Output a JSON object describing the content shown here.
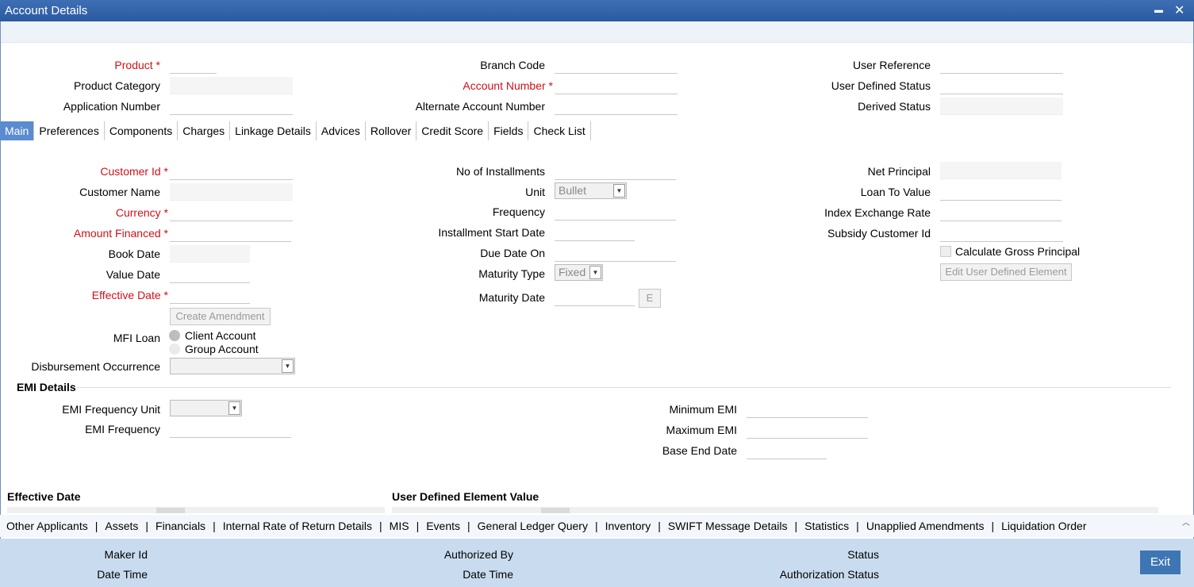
{
  "window": {
    "title": "Account Details",
    "minimize": "▬",
    "close": "✕"
  },
  "header": {
    "product": "Product",
    "product_category": "Product Category",
    "application_number": "Application Number",
    "branch_code": "Branch Code",
    "account_number": "Account Number",
    "alternate_account_number": "Alternate Account Number",
    "user_reference": "User Reference",
    "user_defined_status": "User Defined Status",
    "derived_status": "Derived Status",
    "required_mark": "*"
  },
  "tabs": [
    "Main",
    "Preferences",
    "Components",
    "Charges",
    "Linkage Details",
    "Advices",
    "Rollover",
    "Credit Score",
    "Fields",
    "Check List"
  ],
  "main": {
    "customer_id": "Customer Id",
    "customer_name": "Customer Name",
    "currency": "Currency",
    "amount_financed": "Amount Financed",
    "book_date": "Book Date",
    "value_date": "Value Date",
    "effective_date": "Effective Date",
    "create_amendment": "Create Amendment",
    "mfi_loan": "MFI Loan",
    "client_account": "Client Account",
    "group_account": "Group Account",
    "disbursement_occurrence": "Disbursement Occurrence",
    "no_of_installments": "No of Installments",
    "unit": "Unit",
    "unit_value": "Bullet",
    "frequency": "Frequency",
    "installment_start_date": "Installment Start Date",
    "due_date_on": "Due Date On",
    "maturity_type": "Maturity Type",
    "maturity_type_value": "Fixed",
    "maturity_date": "Maturity Date",
    "e_button": "E",
    "net_principal": "Net Principal",
    "loan_to_value": "Loan To Value",
    "index_exchange_rate": "Index Exchange Rate",
    "subsidy_customer_id": "Subsidy Customer Id",
    "calculate_gross_principal": "Calculate Gross Principal",
    "edit_user_defined_element": "Edit User Defined Element"
  },
  "emi": {
    "section_title": "EMI Details",
    "emi_frequency_unit": "EMI Frequency Unit",
    "emi_frequency": "EMI Frequency",
    "minimum_emi": "Minimum EMI",
    "maximum_emi": "Maximum EMI",
    "base_end_date": "Base End Date"
  },
  "grids": {
    "effective_date": "Effective Date",
    "user_defined_element_value": "User Defined Element Value"
  },
  "links": [
    "Other Applicants",
    "Assets",
    "Financials",
    "Internal Rate of Return Details",
    "MIS",
    "Events",
    "General Ledger Query",
    "Inventory",
    "SWIFT Message Details",
    "Statistics",
    "Unapplied Amendments",
    "Liquidation Order"
  ],
  "link_separator": "|",
  "footer": {
    "maker_id": "Maker Id",
    "date_time": "Date Time",
    "authorized_by": "Authorized By",
    "status": "Status",
    "authorization_status": "Authorization Status",
    "exit": "Exit"
  },
  "colors": {
    "accent": "#3e76b3",
    "required": "#d0101a",
    "footer_bg": "#c9dcef",
    "active_tab": "#5b8bd0"
  }
}
